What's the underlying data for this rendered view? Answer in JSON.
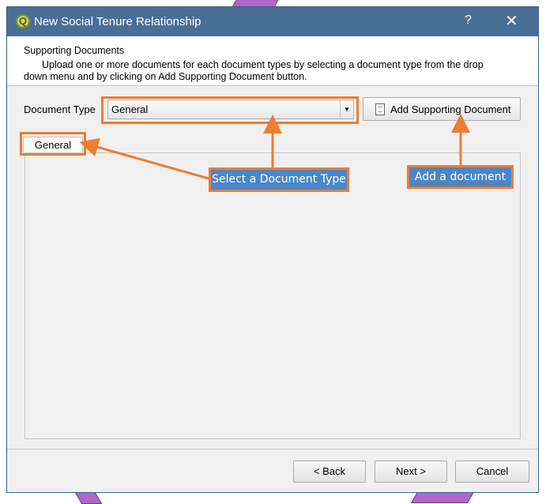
{
  "window": {
    "title": "New Social Tenure Relationship",
    "help": "?",
    "close": "✕",
    "app_icon": "Q"
  },
  "header": {
    "title": "Supporting Documents",
    "description_line1": "Upload one or more documents for each document types by selecting a document type from the drop",
    "description_line2": "down menu and by clicking on Add Supporting Document button."
  },
  "form": {
    "document_type_label": "Document Type",
    "document_type_value": "General",
    "add_button_label": "Add Supporting Document"
  },
  "tabs": [
    {
      "label": "General",
      "active": true
    }
  ],
  "footer": {
    "back": "< Back",
    "next": "Next >",
    "cancel": "Cancel"
  },
  "annotations": {
    "select_callout": "Select a Document  Type",
    "add_callout": "Add  a document",
    "highlight_color": "#ed7d31",
    "callout_color": "#4a86c8"
  }
}
